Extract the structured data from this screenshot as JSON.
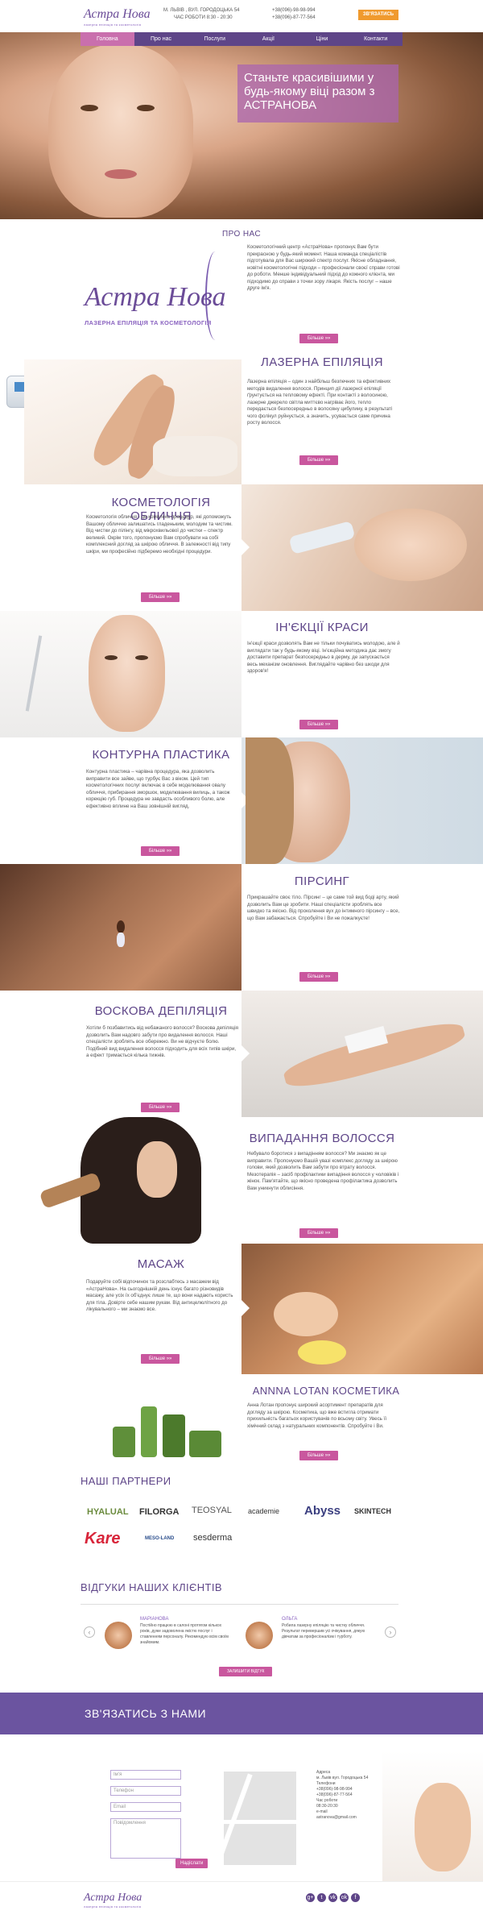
{
  "header": {
    "logo": "Астра Нова",
    "logo_sub": "лазерна епіляція та косметологія",
    "address": "М. ЛЬВІВ , ВУЛ. ГОРОДОЦЬКА 54",
    "hours": "ЧАС РОБОТИ 8:30 - 20:30",
    "phone1": "+38(096)-98-98-994",
    "phone2": "+38(096)-87-77-564",
    "contact_button": "ЗВ'ЯЗАТИСЬ"
  },
  "nav": [
    "Головна",
    "Про нас",
    "Послуги",
    "Акції",
    "Ціни",
    "Контакти"
  ],
  "hero": {
    "title": "Станьте красивішими у будь-якому віці разом з АСТРАНОВА"
  },
  "about": {
    "title": "ПРО НАС",
    "logo": "Астра Нова",
    "logo_sub": "ЛАЗЕРНА ЕПІЛЯЦІЯ ТА КОСМЕТОЛОГІЯ",
    "text": "Косметологічний центр «АстраНова» пропонує Вам бути прекрасною у будь-який момент. Наша команда спеціалістів підготувала для Вас широкий спектр послуг. Якісне обладнання, новітні косметологічні підходи – професіонали своєї справи готові до роботи. Менше індивідуальний підхід до кожного клієнта, ми підходимо до справи з точки зору лікаря. Якість послуг – наше друге ім'я.",
    "more": "Більше »»"
  },
  "services": [
    {
      "title": "ЛАЗЕРНА ЕПІЛЯЦІЯ",
      "text": "Лазерна епіляція – один з найбільш безпечних та ефективних методів видалення волосся. Принцип дії лазерної епіляції ґрунтується на тепловому ефекті. При контакті з волосиною, лазерне джерело світла миттєво нагріває його, тепло передається безпосередньо в волосяну цибулину, в результаті чого фолікул руйнується, а значить, усувається саме причина росту волосся.",
      "more": "Більше »»"
    },
    {
      "title": "КОСМЕТОЛОГІЯ ОБЛИЧЧЯ",
      "text": "Косметологія обличчя - це комплекс процедур, які допоможуть Вашому обличчю залишатись гладеньким, молодим та чистим. Від чистки до пілінгу, від мікрохвильової до чистки – спектр великий. Окрім того, пропонуємо Вам спробувати на собі комплексний догляд за шкірою обличчя. В залежності від типу шкіри, ми професійно підберемо необхідні процедури.",
      "more": "Більше »»"
    },
    {
      "title": "ІН'ЄКЦІЇ КРАСИ",
      "text": "Ін'єкції краси дозволять Вам не тільки почуватись молодою, але й виглядати так у будь-якому віці. Ін'єкційна методика дає змогу доставити препарат безпосередньо в дерму, де запускається весь механізм оновлення. Виглядайте чарівно без шкоди для здоров'я!",
      "more": "Більше »»"
    },
    {
      "title": "КОНТУРНА ПЛАСТИКА",
      "text": "Контурна пластика – чарівна процедура, яка дозволить виправити все зайве, що турбує Вас з віком. Цей тип косметологічних послуг включає в себе моделювання овалу обличчя, прибирання зморшок, моделювання вилиць, а також корекцію губ. Процедура не завдасть особливого болю, але ефективно вплине на Ваш зовнішній вигляд.",
      "more": "Більше »»"
    },
    {
      "title": "ПІРСИНГ",
      "text": "Прикрашайте своє тіло. Пірсинг – це саме той вид боді арту, який дозволить Вам це зробити. Наші спеціалісти зроблять все швидко та якісно. Від проколення вух до інтимного пірсингу – все, що Вам забажається. Спробуйте і Ви не пожалкуєте!",
      "more": "Більше »»"
    },
    {
      "title": "ВОСКОВА ДЕПІЛЯЦІЯ",
      "text": "Хотіли б позбавитись від небажаного волосся? Воскова депіляція дозволить Вам надовго забути про видалення волосся. Наші спеціалісти зроблять все обережно. Ви не відчуєте болю. Подібний вид видалення волосся підходить для всіх типів шкіри, а ефект тримається кілька тижнів.",
      "more": "Більше »»"
    },
    {
      "title": "ВИПАДАННЯ ВОЛОССЯ",
      "text": "Небувало боротися з випадінням волосся? Ми знаємо як це виправити. Пропонуємо Вашій увазі комплекс догляду за шкірою голови, який дозволить Вам забути про втрату волосся. Мезотерапія – засіб профілактики випадіння волосся у чоловіків і жінок. Пам'ятайте, що якісно проведена профілактика дозволить Вам уникнути облисіння.",
      "more": "Більше »»"
    },
    {
      "title": "МАСАЖ",
      "text": "Подаруйте собі відпочинок та розслабтесь з масажем від «АстраНова». На сьогоднішній день існує багато різновидів масажу, але усіх їх об'єднує лише те, що вони надають користь для тіла. Довірте себе нашим рукам. Від антицелюлітного до лікувального – ми знаємо все.",
      "more": "Більше »»"
    },
    {
      "title": "ANNNA LOTAN КОСМЕТИКА",
      "text": "Анна Лотан пропонує широкий асортимент препаратів для догляду за шкірою. Косметика, що вже встигла отримати прихильність багатьох користувачів по всьому світу. Увесь її хімічний склад з натуральних компонентів. Спробуйте і Ви.",
      "more": "Більше »»"
    }
  ],
  "partners": {
    "title": "НАШІ ПАРТНЕРИ",
    "row1": [
      "HYALUAL",
      "FILORGA",
      "TEOSYAL",
      "academie",
      "Abyss",
      "SKINTECH"
    ],
    "row2": [
      "Kare",
      "MESO-LAND",
      "sesderma"
    ]
  },
  "reviews": {
    "title": "ВІДГУКИ НАШИХ КЛІЄНТІВ",
    "items": [
      {
        "name": "МАРІАНОВА",
        "text": "Постійно працюю в салоні протягом кількох років, дуже задоволена якістю послуг і ставленням персоналу. Рекомендую всім своїм знайомим."
      },
      {
        "name": "ОЛЬГА",
        "text": "Робила лазерну епіляцію та чистку обличчя. Результат перевершив усі очікування, дякую дівчатам за професіоналізм і турботу."
      }
    ],
    "button": "ЗАЛИШИТИ ВІДГУК"
  },
  "contact": {
    "title": "ЗВ'ЯЗАТИСЬ З НАМИ",
    "name_ph": "Ім'я",
    "phone_ph": "Телефон",
    "email_ph": "Email",
    "message_ph": "Повідомлення",
    "submit": "Надіслати",
    "info": [
      "Адреса",
      "м. Львів вул. Городоцька 54",
      "Телефони",
      "+38(096)-98-98-994",
      "+38(096)-87-77-564",
      "Час роботи",
      "08:30-20:30",
      "e-mail",
      "astranova@gmail.com"
    ]
  },
  "footer": {
    "logo": "Астра Нова",
    "logo_sub": "лазерна епіляція та косметологія",
    "socials": [
      "g+",
      "t",
      "vk",
      "ok",
      "f"
    ]
  }
}
